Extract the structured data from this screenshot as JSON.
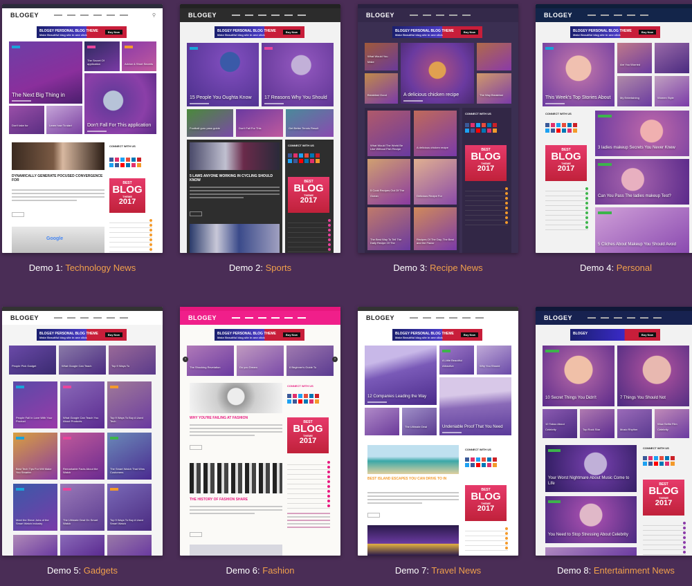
{
  "demos": [
    {
      "label": "Demo 1:",
      "name": "Technology News",
      "logo": "BLOGEY",
      "banner": {
        "title": "BLOGEY PERSONAL BLOG THEME",
        "sub": "Make Beautiful blog site in one click",
        "btn": "Buy Now"
      },
      "tiles": [
        "The Next Big Thing in",
        "The Secret Of application",
        "Advice & Short Secrets",
        "Don't Fall For This application",
        "Don't take for",
        "Learn how To start"
      ],
      "post": "DYNAMICALLY GENERATE POCUSED CONVERGENCE FOR",
      "widget": "CONNECT WITH US",
      "ad": {
        "line1": "BEST",
        "line2": "BLOG",
        "line3": "THEME",
        "line4": "2017",
        "btn": "BUY NOW $99"
      },
      "read_more": "Read More"
    },
    {
      "label": "Demo 2:",
      "name": "Sports",
      "logo": "BLOGEY",
      "banner": {
        "title": "BLOGEY PERSONAL BLOG THEME",
        "sub": "Make Beautiful blog site in one click",
        "btn": "Buy Now"
      },
      "tiles": [
        "15 People You Oughta Know",
        "17 Reasons Why You Should",
        "Football guru pass guide",
        "Don't Fall For This",
        "Get Better Tennis Result"
      ],
      "post": "5 LAWS ANYONE WORKING IN CYCLING SHOULD KNOW",
      "widget": "CONNECT WITH US",
      "ad": {
        "line1": "BEST",
        "line2": "BLOG",
        "line3": "THEME",
        "line4": "2017",
        "btn": "BUY NOW $99"
      },
      "read_more": "Read More"
    },
    {
      "label": "Demo 3:",
      "name": "Recipe News",
      "logo": "BLOGEY",
      "banner": {
        "title": "BLOGEY PERSONAL BLOG THEME",
        "sub": "Make Beautiful blog site in one click",
        "btn": "Buy Now"
      },
      "tiles": [
        "A delicious chicken recipe",
        "What Would You Make",
        "Breakfast Good",
        "The Way Breakfast",
        "What Would The World Be Like Without Fish Recipe",
        "A delicious chicken recipe",
        "5 Cook Recipes Out Of The Ocean",
        "Delicious Recipe For",
        "The Best Way To Tell The Daily Recipe Of The",
        "Recipes Of The Day, The Best and the Flavor"
      ],
      "widget": "CONNECT WITH US",
      "ad": {
        "line1": "BEST",
        "line2": "BLOG",
        "line3": "THEME",
        "line4": "2017",
        "btn": "BUY NOW $99"
      }
    },
    {
      "label": "Demo 4:",
      "name": "Personal",
      "logo": "BLOGEY",
      "banner": {
        "title": "BLOGEY PERSONAL BLOG THEME",
        "sub": "Make Beautiful blog site in one click",
        "btn": "Buy Now"
      },
      "tiles": [
        "This Week's Top Stories About",
        "Are You Worried",
        "My Entertaining",
        "Women Style",
        "3 ladies makeup Secrets You Never Knew",
        "Can You Pass The ladies makeup Test?",
        "5 Cliches About Makeup You Should Avoid"
      ],
      "widget": "CONNECT WITH US",
      "ad": {
        "line1": "BEST",
        "line2": "BLOG",
        "line3": "THEME",
        "line4": "2017",
        "btn": "BUY NOW $99"
      }
    },
    {
      "label": "Demo 5:",
      "name": "Gadgets",
      "logo": "BLOGEY",
      "banner": {
        "title": "BLOGEY PERSONAL BLOG THEME",
        "sub": "Make Beautiful blog site in one click",
        "btn": "Buy Now"
      },
      "tiles": [
        "People Pick Gadget",
        "What Google Can Teach",
        "Top 9 Ways To",
        "People Fall In Love With Your Product",
        "What Google Can Teach You About Products",
        "Top 9 Ways To Buy A Used Tech",
        "Best Tech Tips For Will Make You Smarter",
        "Remarkable Facts About the Watch",
        "The Smart Watch That Wins Customers",
        "Meet the Steve Jobs of the Smart Watch Industry",
        "The Ultimate Deal On Smart Watch",
        "Top 9 Ways To Buy A Used Smart Watch"
      ]
    },
    {
      "label": "Demo 6:",
      "name": "Fashion",
      "logo": "BLOGEY",
      "banner": {
        "title": "BLOGEY PERSONAL BLOG THEME",
        "sub": "Make Beautiful blog site in one click",
        "btn": "Buy Now"
      },
      "tiles": [
        "The Shocking Revelation",
        "Do you Dream",
        "6 Beginner's Guide To"
      ],
      "post": "WHY YOU'RE FAILING AT FASHION",
      "post2": "THE HISTORY OF FASHION SHARE",
      "widget": "CONNECT WITH US",
      "ad": {
        "line1": "BEST",
        "line2": "BLOG",
        "line3": "THEME",
        "line4": "2017",
        "btn": "BUY NOW $99"
      },
      "read_more": "Read More"
    },
    {
      "label": "Demo 7:",
      "name": "Travel News",
      "logo": "BLOGEY",
      "banner": {
        "title": "BLOGEY PERSONAL BLOG THEME",
        "sub": "Make Beautiful blog site in one click",
        "btn": "Buy Now"
      },
      "tiles": [
        "12 Companies Leading the Way",
        "A Little Beautiful Attractive",
        "Why You Should",
        "The Ultimate Deal",
        "Undeniable Proof That You Need"
      ],
      "post": "BEST ISLAND ESCAPES YOU CAN DRIVE TO IN",
      "widget": "CONNECT WITH US",
      "ad": {
        "line1": "BEST",
        "line2": "BLOG",
        "line3": "THEME",
        "line4": "2017",
        "btn": "BUY NOW $99"
      },
      "read_more": "Read More"
    },
    {
      "label": "Demo 8:",
      "name": "Entertainment News",
      "logo": "BLOGEY",
      "banner": {
        "title": "BLOGEY",
        "sub": "",
        "btn": "Buy Now"
      },
      "tiles": [
        "10 Secret Things You Didn't",
        "7 Things You Should Not",
        "10 Taboo About Celebrity",
        "Top Rock Star",
        "Music Rhythm",
        "Wow Selfie Film Celebrity",
        "Your Worst Nightmare About Music Come to Life",
        "You Need to Stop Stressing About Celebrity"
      ],
      "widget": "CONNECT WITH US",
      "ad": {
        "line1": "BEST",
        "line2": "BLOG",
        "line3": "THEME",
        "line4": "2017",
        "btn": "BUY NOW $99"
      }
    }
  ]
}
